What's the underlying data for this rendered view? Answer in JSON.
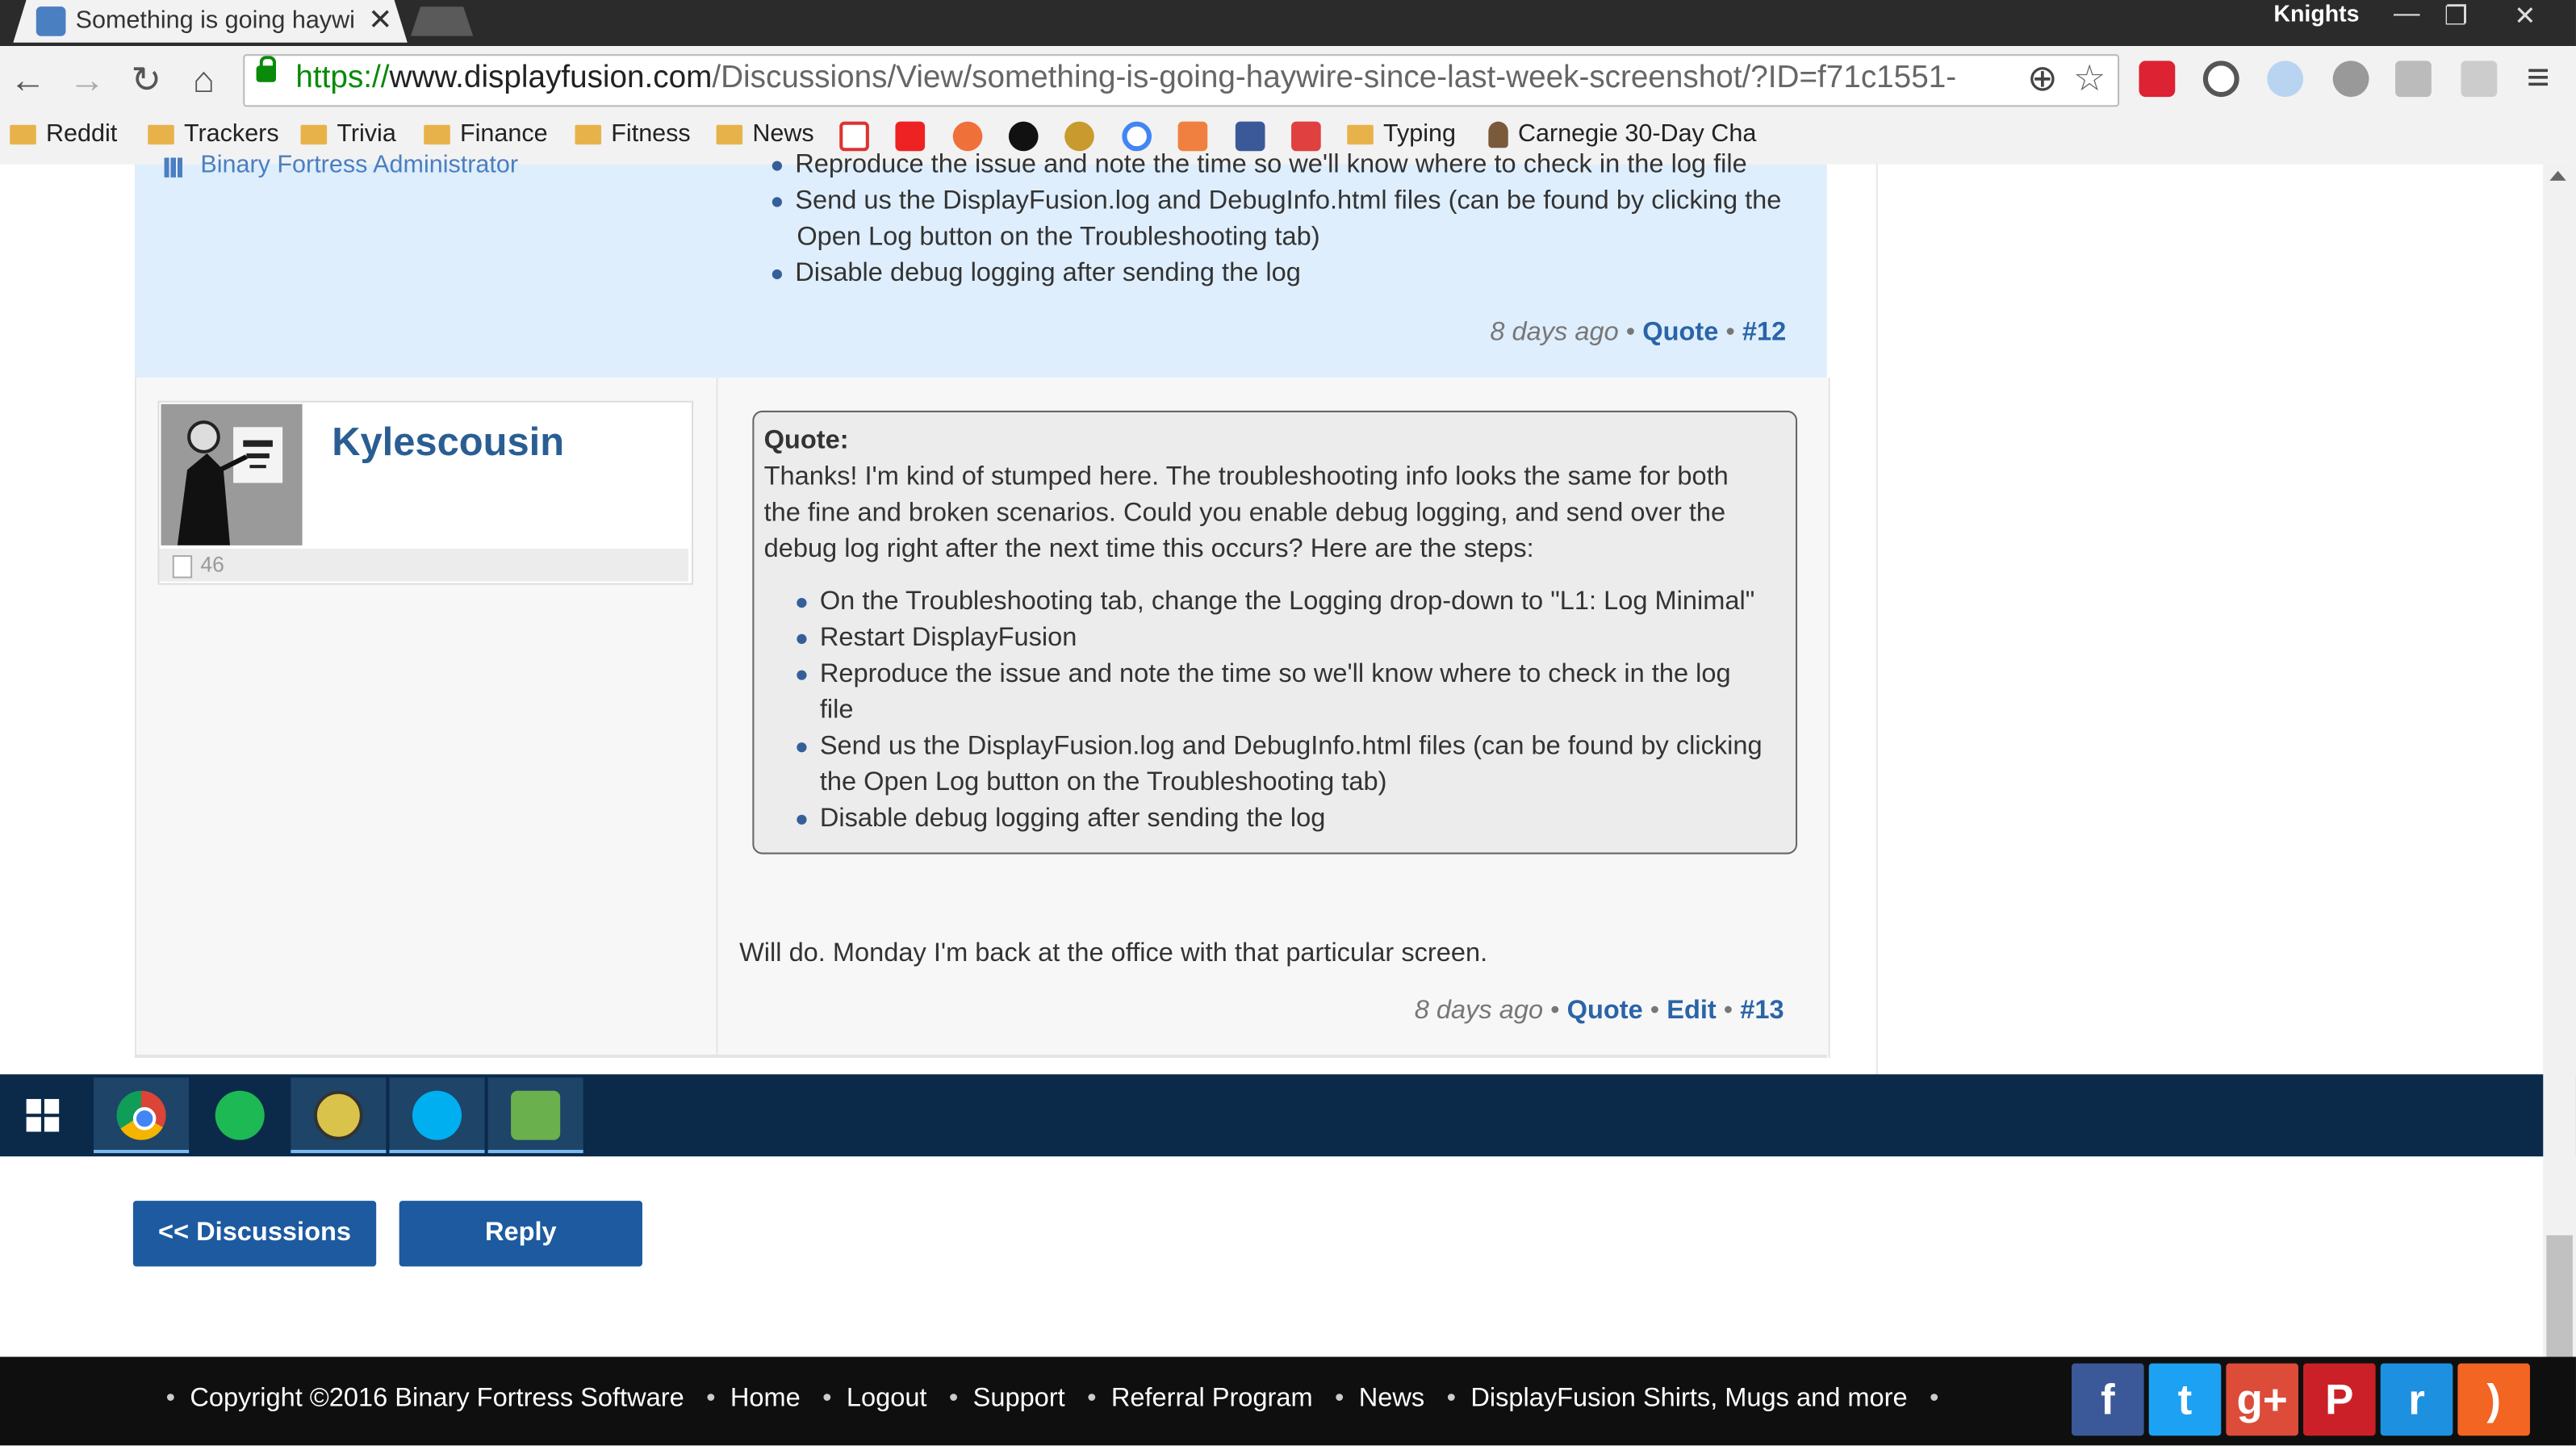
{
  "browser": {
    "tab_title": "Something is going haywire",
    "tab_close": "✕",
    "profile_name": "Knights",
    "url_https": "https://",
    "url_host": "www.displayfusion.com",
    "url_path": "/Discussions/View/something-is-going-haywire-since-last-week-screenshot/?ID=f71c1551-",
    "win_min": "—",
    "win_max": "❐",
    "win_close": "✕",
    "nav_back": "←",
    "nav_forward": "→",
    "nav_reload": "↻",
    "nav_home": "⌂",
    "zoom_icon": "⊕",
    "star_icon": "☆",
    "menu_icon": "≡"
  },
  "bookmarks": [
    {
      "label": "Reddit"
    },
    {
      "label": "Trackers"
    },
    {
      "label": "Trivia"
    },
    {
      "label": "Finance"
    },
    {
      "label": "Fitness"
    },
    {
      "label": "News"
    },
    {
      "label": "Typing"
    },
    {
      "label": "Carnegie 30-Day Cha"
    }
  ],
  "post12": {
    "role": "Binary Fortress Administrator",
    "items": [
      "Reproduce the issue and note the time so we'll know where to check in the log file",
      "Send us the DisplayFusion.log and DebugInfo.html files (can be found by clicking the",
      "Open Log button on the Troubleshooting tab)",
      "Disable debug logging after sending the log"
    ],
    "time": "8 days ago",
    "quote": "Quote",
    "num": "#12"
  },
  "post13": {
    "username": "Kylescousin",
    "post_count": "46",
    "quote_label": "Quote:",
    "quote_lines": [
      "Thanks! I'm kind of stumped here. The troubleshooting info looks the same for both",
      "the fine and broken scenarios. Could you enable debug logging, and send over the",
      "debug log right after the next time this occurs? Here are the steps:"
    ],
    "quote_items": [
      "On the Troubleshooting tab, change the Logging drop-down to \"L1: Log Minimal\"",
      "Restart DisplayFusion",
      "Reproduce the issue and note the time so we'll know where to check in the log",
      "file",
      "Send us the DisplayFusion.log and DebugInfo.html files (can be found by clicking",
      "the Open Log button on the Troubleshooting tab)",
      "Disable debug logging after sending the log"
    ],
    "body": "Will do. Monday I'm back at the office with that particular screen.",
    "time": "8 days ago",
    "quote": "Quote",
    "edit": "Edit",
    "num": "#13"
  },
  "buttons": {
    "discussions": "<< Discussions",
    "reply": "Reply"
  },
  "footer": {
    "copyright": "Copyright ©2016 Binary Fortress Software",
    "links": [
      "Home",
      "Logout",
      "Support",
      "Referral Program",
      "News",
      "DisplayFusion Shirts, Mugs and more"
    ]
  },
  "taskbar": {
    "items": [
      "chrome-icon",
      "spotify-icon",
      "hs-icon",
      "skype-icon",
      "evernote-icon"
    ]
  },
  "social": [
    "facebook-icon",
    "twitter-icon",
    "google-plus-icon",
    "pinterest-icon",
    "reddit-icon",
    "rss-icon"
  ],
  "social_glyphs": {
    "facebook": "f",
    "twitter": "t",
    "gplus": "g+",
    "pinterest": "P",
    "reddit": "r",
    "rss": ")"
  }
}
